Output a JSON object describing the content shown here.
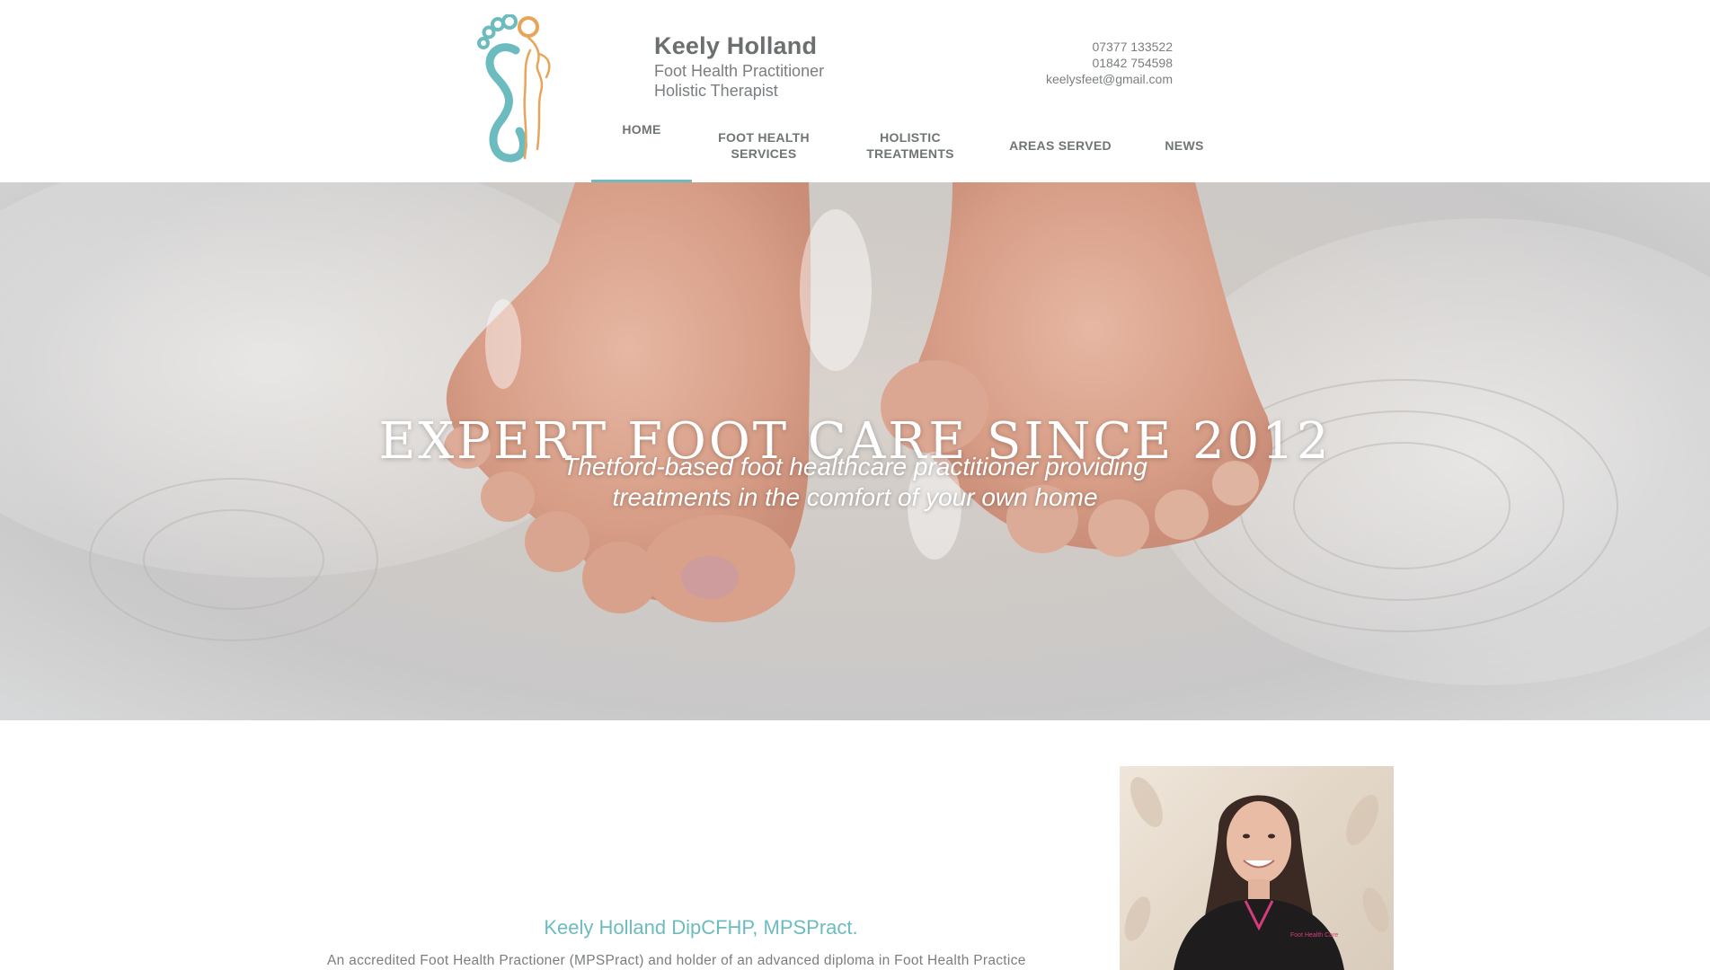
{
  "header": {
    "brand_name": "Keely Holland",
    "brand_lines": [
      "Foot Health Practitioner",
      "Holistic Therapist"
    ],
    "contact": {
      "phone1": "07377 133522",
      "phone2": "01842 754598",
      "email": "keelysfeet@gmail.com"
    }
  },
  "nav": {
    "items": [
      {
        "lines": [
          "HOME"
        ],
        "active": true
      },
      {
        "lines": [
          "FOOT HEALTH",
          "SERVICES"
        ],
        "active": false
      },
      {
        "lines": [
          "HOLISTIC",
          "TREATMENTS"
        ],
        "active": false
      },
      {
        "lines": [
          "AREAS SERVED"
        ],
        "active": false
      },
      {
        "lines": [
          "NEWS"
        ],
        "active": false
      }
    ]
  },
  "hero": {
    "title": "EXPERT FOOT CARE SINCE 2012",
    "subtitle_lines": [
      "Thetford-based foot healthcare practitioner providing",
      "treatments in the comfort of your own home"
    ]
  },
  "about": {
    "heading": "Keely Holland DipCFHP, MPSPract.",
    "text": "An accredited Foot Health Practioner (MPSPract) and holder of an advanced diploma in Foot Health Practice"
  },
  "colors": {
    "accent": "#6cbcbf",
    "logo_orange": "#e8a55a",
    "text": "#6b6f70"
  },
  "icons": {
    "logo": "footprint-figure-logo"
  }
}
